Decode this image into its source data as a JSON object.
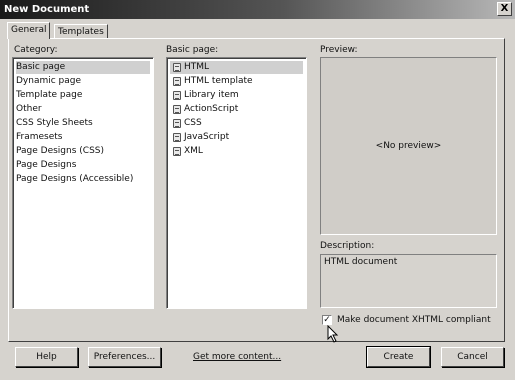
{
  "window": {
    "title": "New Document",
    "close_glyph": "X"
  },
  "tabs": [
    {
      "label": "General",
      "active": true
    },
    {
      "label": "Templates",
      "active": false
    }
  ],
  "category": {
    "label": "Category:",
    "items": [
      "Basic page",
      "Dynamic page",
      "Template page",
      "Other",
      "CSS Style Sheets",
      "Framesets",
      "Page Designs (CSS)",
      "Page Designs",
      "Page Designs (Accessible)"
    ],
    "selected": "Basic page"
  },
  "basic_page": {
    "label": "Basic page:",
    "items": [
      "HTML",
      "HTML template",
      "Library item",
      "ActionScript",
      "CSS",
      "JavaScript",
      "XML"
    ],
    "selected": "HTML",
    "icon": "document-icon"
  },
  "preview": {
    "label": "Preview:",
    "placeholder": "<No preview>"
  },
  "description": {
    "label": "Description:",
    "text": "HTML document"
  },
  "xhtml": {
    "label": "Make document XHTML compliant",
    "checked": true,
    "mark": "✓"
  },
  "buttons": {
    "help": "Help",
    "preferences": "Preferences...",
    "get_more": "Get more content...",
    "create": "Create",
    "cancel": "Cancel"
  }
}
